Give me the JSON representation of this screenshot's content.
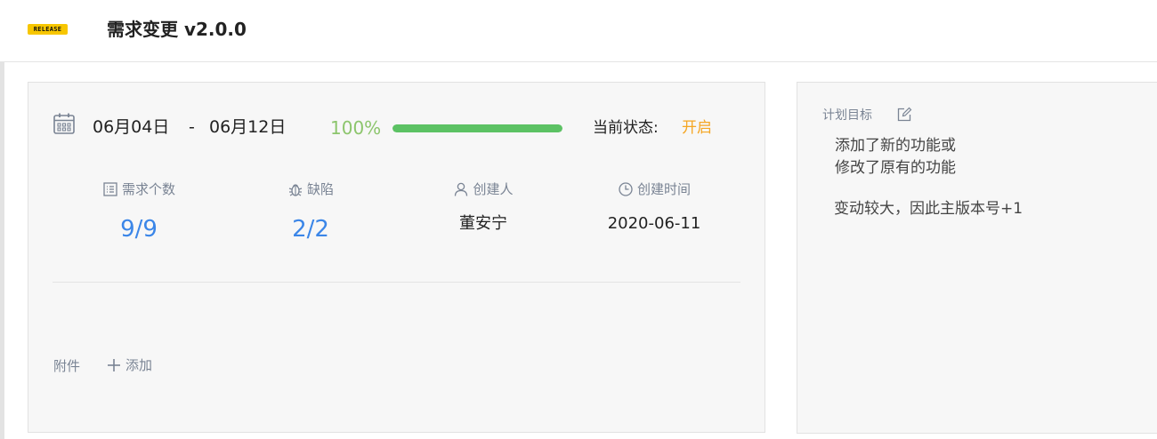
{
  "header": {
    "badge": "RELEASE",
    "title": "需求变更 v2.0.0"
  },
  "plan": {
    "date_start": "06月04日",
    "date_separator": "-",
    "date_end": "06月12日",
    "progress_text": "100%",
    "progress_value": 100,
    "status_label": "当前状态:",
    "status_value": "开启"
  },
  "stats": [
    {
      "icon": "list-icon",
      "label": "需求个数",
      "value": "9/9"
    },
    {
      "icon": "bug-icon",
      "label": "缺陷",
      "value": "2/2"
    },
    {
      "icon": "user-icon",
      "label": "创建人",
      "value": "董安宁"
    },
    {
      "icon": "clock-icon",
      "label": "创建时间",
      "value": "2020-06-11"
    }
  ],
  "attachments": {
    "label": "附件",
    "add_label": "添加"
  },
  "goal": {
    "label": "计划目标",
    "lines": [
      " 添加了新的功能或",
      "修改了原有的功能",
      "变动较大，因此主版本号+1"
    ]
  },
  "colors": {
    "accent_blue": "#3b86e8",
    "progress_green": "#5cc264",
    "status_orange": "#f5a623",
    "badge_yellow": "#f7c600"
  }
}
